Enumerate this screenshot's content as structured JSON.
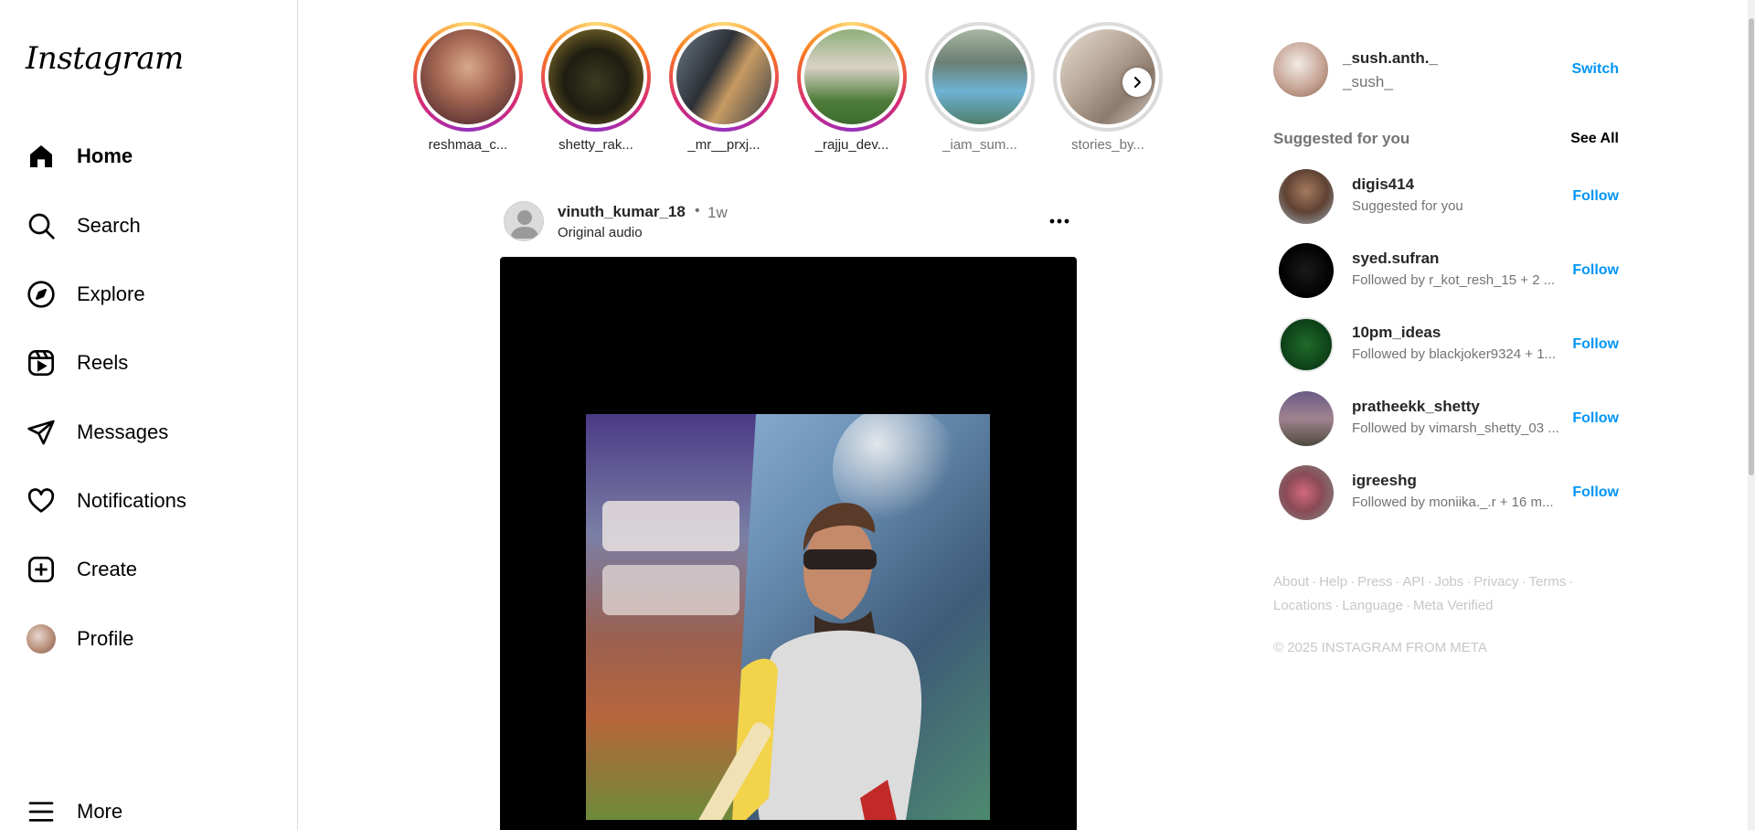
{
  "app": {
    "logo_text": "Instagram",
    "accent": "#0095f6"
  },
  "sidebar": {
    "items": [
      {
        "label": "Home",
        "icon": "home-icon",
        "active": true
      },
      {
        "label": "Search",
        "icon": "search-icon"
      },
      {
        "label": "Explore",
        "icon": "compass-icon"
      },
      {
        "label": "Reels",
        "icon": "reels-icon"
      },
      {
        "label": "Messages",
        "icon": "paper-plane-icon"
      },
      {
        "label": "Notifications",
        "icon": "heart-icon"
      },
      {
        "label": "Create",
        "icon": "plus-square-icon"
      },
      {
        "label": "Profile",
        "icon": "avatar"
      }
    ],
    "more_label": "More"
  },
  "stories": [
    {
      "name": "reshmaa_c...",
      "seen": false
    },
    {
      "name": "shetty_rak...",
      "seen": false
    },
    {
      "name": "_mr__prxj...",
      "seen": false
    },
    {
      "name": "_rajju_dev...",
      "seen": false
    },
    {
      "name": "_iam_sum...",
      "seen": true
    },
    {
      "name": "stories_by...",
      "seen": true
    }
  ],
  "post": {
    "username": "vinuth_kumar_18",
    "separator": "•",
    "time": "1w",
    "audio": "Original audio"
  },
  "right": {
    "me": {
      "username": "_sush.anth._",
      "fullname": "_sush_"
    },
    "switch_label": "Switch",
    "suggested_title": "Suggested for you",
    "see_all_label": "See All",
    "follow_label": "Follow",
    "suggestions": [
      {
        "name": "digis414",
        "subtitle": "Suggested for you"
      },
      {
        "name": "syed.sufran",
        "subtitle": "Followed by r_kot_resh_15 + 2 ..."
      },
      {
        "name": "10pm_ideas",
        "subtitle": "Followed by blackjoker9324 + 1..."
      },
      {
        "name": "pratheekk_shetty",
        "subtitle": "Followed by vimarsh_shetty_03 ..."
      },
      {
        "name": "igreeshg",
        "subtitle": "Followed by moniika._.r + 16 m..."
      }
    ],
    "footer_links": [
      "About",
      "Help",
      "Press",
      "API",
      "Jobs",
      "Privacy",
      "Terms",
      "Locations",
      "Language",
      "Meta Verified"
    ],
    "footer_separator": "·",
    "copyright": "© 2025 INSTAGRAM FROM META"
  }
}
